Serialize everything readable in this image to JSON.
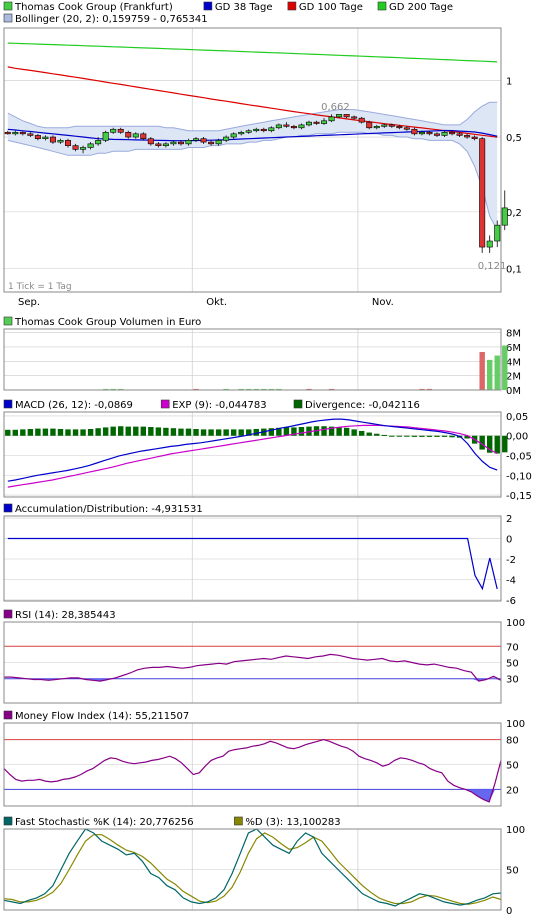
{
  "legend": {
    "main": [
      {
        "label": "Thomas Cook Group (Frankfurt)",
        "color": "#44cc44",
        "bordered": true
      },
      {
        "label": "GD 38 Tage",
        "color": "#0000cc"
      },
      {
        "label": "GD 100 Tage",
        "color": "#dd0000"
      },
      {
        "label": "GD 200 Tage",
        "color": "#22cc22"
      },
      {
        "label": "Bollinger (20, 2): 0,159759 - 0,765341",
        "color": "#aabbdd"
      }
    ],
    "volume": {
      "label": "Thomas Cook Group Volumen in Euro",
      "color": "#55cc55"
    },
    "macd": [
      {
        "label": "MACD (26, 12): -0,0869",
        "color": "#0000cc"
      },
      {
        "label": "EXP (9): -0,044783",
        "color": "#cc00cc"
      },
      {
        "label": "Divergence: -0,042116",
        "color": "#006600"
      }
    ],
    "ad": {
      "label": "Accumulation/Distribution: -4,931531",
      "color": "#0000cc"
    },
    "rsi": {
      "label": "RSI (14): 28,385443",
      "color": "#880088"
    },
    "mfi": {
      "label": "Money Flow Index (14): 55,211507",
      "color": "#880088"
    },
    "stoch": [
      {
        "label": "Fast Stochastic %K (14): 20,776256",
        "color": "#006666"
      },
      {
        "label": "%D (3): 13,100283",
        "color": "#888800"
      }
    ]
  },
  "x_axis": {
    "labels": [
      "Sep.",
      "Okt.",
      "Nov."
    ],
    "positions": [
      0,
      25,
      47
    ]
  },
  "main_axis": {
    "ticks": [
      "1",
      "0,5",
      "0,2",
      "0,1"
    ],
    "values": [
      1,
      0.5,
      0.2,
      0.1
    ],
    "ylim": [
      0.075,
      1.9
    ],
    "scale": "log"
  },
  "annotations": {
    "high_label": "0,662",
    "high_index": 44,
    "high_value": 0.662,
    "low_label": "0,121",
    "low_index": 64,
    "low_value": 0.121,
    "tick_note": "1 Tick = 1 Tag"
  },
  "volume_axis": {
    "ticks": [
      "8M",
      "6M",
      "4M",
      "2M",
      "0M"
    ],
    "values": [
      8,
      6,
      4,
      2,
      0
    ],
    "ylim": [
      0,
      8.5
    ]
  },
  "macd_axis": {
    "ticks": [
      "0,05",
      "0,00",
      "-0,05",
      "-0,10",
      "-0,15"
    ],
    "values": [
      0.05,
      0,
      -0.05,
      -0.1,
      -0.15
    ],
    "ylim": [
      -0.155,
      0.06
    ]
  },
  "ad_axis": {
    "ticks": [
      "2",
      "0",
      "-2",
      "-4",
      "-6"
    ],
    "values": [
      2,
      0,
      -2,
      -4,
      -6
    ],
    "ylim": [
      -6.1,
      2.2
    ]
  },
  "rsi_axis": {
    "ticks": [
      "100",
      "70",
      "50",
      "30"
    ],
    "values": [
      100,
      70,
      50,
      30
    ],
    "ylim": [
      0,
      100
    ],
    "upper": 70,
    "lower": 30
  },
  "mfi_axis": {
    "ticks": [
      "100",
      "80",
      "50",
      "20"
    ],
    "values": [
      100,
      80,
      50,
      20
    ],
    "ylim": [
      0,
      100
    ],
    "upper": 80,
    "lower": 20
  },
  "stoch_axis": {
    "ticks": [
      "100",
      "50",
      "0"
    ],
    "values": [
      100,
      50,
      0
    ],
    "ylim": [
      0,
      100
    ]
  },
  "colors": {
    "up": "#44cc44",
    "down": "#dd3333",
    "grid": "#cccccc",
    "band": "#dde6f5",
    "band_line": "#99aadd",
    "panel_border": "#888888",
    "vol_up": "#66cc66",
    "vol_down": "#dd6666"
  },
  "chart_data": {
    "type": "line",
    "x_count": 66,
    "candles": [
      [
        0.53,
        0.52,
        0.54,
        0.515
      ],
      [
        0.52,
        0.53,
        0.54,
        0.51
      ],
      [
        0.53,
        0.52,
        0.535,
        0.51
      ],
      [
        0.52,
        0.51,
        0.53,
        0.5
      ],
      [
        0.51,
        0.49,
        0.52,
        0.48
      ],
      [
        0.49,
        0.5,
        0.51,
        0.48
      ],
      [
        0.5,
        0.47,
        0.51,
        0.46
      ],
      [
        0.47,
        0.48,
        0.49,
        0.46
      ],
      [
        0.48,
        0.45,
        0.49,
        0.44
      ],
      [
        0.45,
        0.43,
        0.46,
        0.42
      ],
      [
        0.43,
        0.44,
        0.45,
        0.41
      ],
      [
        0.44,
        0.46,
        0.47,
        0.43
      ],
      [
        0.46,
        0.48,
        0.5,
        0.45
      ],
      [
        0.48,
        0.53,
        0.54,
        0.47
      ],
      [
        0.53,
        0.55,
        0.56,
        0.52
      ],
      [
        0.55,
        0.53,
        0.56,
        0.52
      ],
      [
        0.53,
        0.5,
        0.54,
        0.49
      ],
      [
        0.5,
        0.52,
        0.53,
        0.49
      ],
      [
        0.52,
        0.49,
        0.53,
        0.48
      ],
      [
        0.49,
        0.46,
        0.5,
        0.45
      ],
      [
        0.46,
        0.45,
        0.47,
        0.44
      ],
      [
        0.45,
        0.46,
        0.47,
        0.44
      ],
      [
        0.46,
        0.47,
        0.48,
        0.45
      ],
      [
        0.47,
        0.46,
        0.48,
        0.45
      ],
      [
        0.46,
        0.48,
        0.49,
        0.45
      ],
      [
        0.48,
        0.49,
        0.5,
        0.47
      ],
      [
        0.49,
        0.47,
        0.5,
        0.46
      ],
      [
        0.47,
        0.46,
        0.48,
        0.45
      ],
      [
        0.46,
        0.48,
        0.49,
        0.45
      ],
      [
        0.48,
        0.5,
        0.51,
        0.47
      ],
      [
        0.5,
        0.52,
        0.53,
        0.49
      ],
      [
        0.52,
        0.53,
        0.54,
        0.51
      ],
      [
        0.53,
        0.54,
        0.55,
        0.52
      ],
      [
        0.54,
        0.55,
        0.56,
        0.53
      ],
      [
        0.55,
        0.54,
        0.56,
        0.53
      ],
      [
        0.54,
        0.56,
        0.57,
        0.53
      ],
      [
        0.56,
        0.58,
        0.59,
        0.55
      ],
      [
        0.58,
        0.57,
        0.6,
        0.56
      ],
      [
        0.57,
        0.56,
        0.58,
        0.55
      ],
      [
        0.56,
        0.58,
        0.59,
        0.55
      ],
      [
        0.58,
        0.6,
        0.61,
        0.57
      ],
      [
        0.6,
        0.59,
        0.61,
        0.58
      ],
      [
        0.59,
        0.61,
        0.63,
        0.58
      ],
      [
        0.61,
        0.64,
        0.66,
        0.6
      ],
      [
        0.64,
        0.66,
        0.662,
        0.63
      ],
      [
        0.66,
        0.64,
        0.66,
        0.63
      ],
      [
        0.64,
        0.63,
        0.65,
        0.62
      ],
      [
        0.63,
        0.6,
        0.64,
        0.59
      ],
      [
        0.6,
        0.56,
        0.61,
        0.55
      ],
      [
        0.56,
        0.57,
        0.58,
        0.55
      ],
      [
        0.57,
        0.58,
        0.59,
        0.56
      ],
      [
        0.58,
        0.57,
        0.59,
        0.56
      ],
      [
        0.57,
        0.56,
        0.58,
        0.55
      ],
      [
        0.56,
        0.55,
        0.57,
        0.54
      ],
      [
        0.55,
        0.52,
        0.56,
        0.51
      ],
      [
        0.52,
        0.53,
        0.54,
        0.51
      ],
      [
        0.53,
        0.52,
        0.54,
        0.51
      ],
      [
        0.52,
        0.51,
        0.53,
        0.5
      ],
      [
        0.51,
        0.53,
        0.54,
        0.5
      ],
      [
        0.53,
        0.52,
        0.54,
        0.51
      ],
      [
        0.52,
        0.51,
        0.53,
        0.5
      ],
      [
        0.51,
        0.5,
        0.52,
        0.49
      ],
      [
        0.5,
        0.49,
        0.51,
        0.48
      ],
      [
        0.49,
        0.13,
        0.5,
        0.121
      ],
      [
        0.13,
        0.14,
        0.15,
        0.121
      ],
      [
        0.14,
        0.17,
        0.18,
        0.13
      ],
      [
        0.17,
        0.21,
        0.26,
        0.16
      ]
    ],
    "ma38": [
      0.55,
      0.545,
      0.54,
      0.535,
      0.53,
      0.525,
      0.52,
      0.515,
      0.51,
      0.505,
      0.5,
      0.495,
      0.49,
      0.488,
      0.486,
      0.485,
      0.484,
      0.483,
      0.482,
      0.481,
      0.48,
      0.479,
      0.478,
      0.478,
      0.478,
      0.479,
      0.48,
      0.481,
      0.482,
      0.484,
      0.486,
      0.488,
      0.49,
      0.492,
      0.494,
      0.496,
      0.498,
      0.5,
      0.502,
      0.504,
      0.506,
      0.508,
      0.51,
      0.512,
      0.514,
      0.516,
      0.518,
      0.52,
      0.522,
      0.524,
      0.526,
      0.528,
      0.53,
      0.532,
      0.534,
      0.536,
      0.538,
      0.54,
      0.542,
      0.541,
      0.538,
      0.535,
      0.532,
      0.525,
      0.515,
      0.505
    ],
    "ma100": [
      1.18,
      1.16,
      1.145,
      1.13,
      1.115,
      1.1,
      1.085,
      1.07,
      1.055,
      1.04,
      1.025,
      1.01,
      0.995,
      0.98,
      0.966,
      0.952,
      0.938,
      0.924,
      0.91,
      0.897,
      0.884,
      0.871,
      0.858,
      0.845,
      0.833,
      0.821,
      0.809,
      0.797,
      0.786,
      0.775,
      0.764,
      0.753,
      0.742,
      0.732,
      0.722,
      0.712,
      0.702,
      0.692,
      0.683,
      0.674,
      0.665,
      0.656,
      0.648,
      0.64,
      0.632,
      0.624,
      0.617,
      0.61,
      0.603,
      0.596,
      0.589,
      0.583,
      0.577,
      0.571,
      0.565,
      0.559,
      0.553,
      0.547,
      0.541,
      0.535,
      0.529,
      0.523,
      0.517,
      0.511,
      0.505,
      0.499
    ],
    "ma200": [
      1.58,
      1.575,
      1.57,
      1.565,
      1.56,
      1.555,
      1.55,
      1.545,
      1.54,
      1.535,
      1.53,
      1.525,
      1.52,
      1.515,
      1.51,
      1.505,
      1.5,
      1.495,
      1.49,
      1.485,
      1.48,
      1.475,
      1.47,
      1.465,
      1.46,
      1.455,
      1.45,
      1.445,
      1.44,
      1.435,
      1.43,
      1.425,
      1.42,
      1.415,
      1.41,
      1.405,
      1.4,
      1.395,
      1.39,
      1.385,
      1.38,
      1.375,
      1.37,
      1.365,
      1.36,
      1.355,
      1.35,
      1.345,
      1.34,
      1.335,
      1.33,
      1.325,
      1.32,
      1.315,
      1.31,
      1.305,
      1.3,
      1.295,
      1.29,
      1.285,
      1.28,
      1.275,
      1.27,
      1.265,
      1.26,
      1.255
    ],
    "boll_upper": [
      0.67,
      0.64,
      0.61,
      0.59,
      0.57,
      0.56,
      0.56,
      0.56,
      0.56,
      0.57,
      0.57,
      0.57,
      0.57,
      0.57,
      0.57,
      0.57,
      0.57,
      0.57,
      0.57,
      0.57,
      0.57,
      0.56,
      0.56,
      0.55,
      0.54,
      0.54,
      0.54,
      0.54,
      0.54,
      0.55,
      0.56,
      0.57,
      0.58,
      0.59,
      0.6,
      0.61,
      0.62,
      0.63,
      0.64,
      0.65,
      0.66,
      0.67,
      0.68,
      0.69,
      0.7,
      0.7,
      0.7,
      0.69,
      0.68,
      0.67,
      0.66,
      0.65,
      0.64,
      0.63,
      0.62,
      0.61,
      0.6,
      0.59,
      0.58,
      0.58,
      0.58,
      0.62,
      0.68,
      0.73,
      0.765,
      0.765
    ],
    "boll_lower": [
      0.48,
      0.47,
      0.46,
      0.45,
      0.44,
      0.43,
      0.42,
      0.41,
      0.4,
      0.4,
      0.4,
      0.4,
      0.41,
      0.41,
      0.42,
      0.42,
      0.42,
      0.43,
      0.43,
      0.43,
      0.43,
      0.43,
      0.43,
      0.43,
      0.44,
      0.44,
      0.44,
      0.45,
      0.45,
      0.46,
      0.46,
      0.46,
      0.47,
      0.47,
      0.48,
      0.48,
      0.49,
      0.5,
      0.5,
      0.51,
      0.51,
      0.52,
      0.52,
      0.52,
      0.53,
      0.53,
      0.53,
      0.53,
      0.52,
      0.52,
      0.51,
      0.51,
      0.5,
      0.5,
      0.49,
      0.49,
      0.48,
      0.48,
      0.48,
      0.48,
      0.46,
      0.42,
      0.35,
      0.27,
      0.19,
      0.16
    ],
    "volume": [
      0,
      0,
      0,
      0,
      0,
      0,
      0,
      0,
      0,
      0,
      0,
      0,
      0,
      0.15,
      0.15,
      0.15,
      0,
      0,
      0,
      0,
      0,
      0,
      0,
      0,
      0,
      0.15,
      0,
      0,
      0,
      0.15,
      0,
      0.15,
      0.15,
      0.15,
      0.15,
      0.15,
      0.15,
      0,
      0,
      0,
      0.15,
      0,
      0,
      0.15,
      0,
      0,
      0,
      0,
      0,
      0,
      0,
      0,
      0,
      0,
      0,
      0.15,
      0.15,
      0,
      0,
      0,
      0,
      0,
      0,
      5.3,
      4.2,
      4.8,
      6.2
    ],
    "volume_up": [
      1,
      1,
      1,
      1,
      1,
      1,
      1,
      1,
      1,
      1,
      1,
      1,
      1,
      1,
      1,
      1,
      1,
      1,
      1,
      1,
      1,
      1,
      1,
      1,
      1,
      0,
      1,
      1,
      1,
      1,
      1,
      1,
      1,
      1,
      1,
      1,
      1,
      1,
      1,
      1,
      0,
      1,
      1,
      0,
      1,
      1,
      1,
      1,
      1,
      1,
      1,
      1,
      1,
      1,
      1,
      0,
      0,
      1,
      1,
      1,
      1,
      1,
      1,
      0,
      1,
      1,
      1
    ],
    "macd": [
      -0.115,
      -0.112,
      -0.108,
      -0.104,
      -0.1,
      -0.097,
      -0.094,
      -0.091,
      -0.088,
      -0.084,
      -0.08,
      -0.075,
      -0.069,
      -0.063,
      -0.057,
      -0.051,
      -0.047,
      -0.043,
      -0.039,
      -0.036,
      -0.033,
      -0.03,
      -0.027,
      -0.025,
      -0.022,
      -0.02,
      -0.018,
      -0.015,
      -0.012,
      -0.009,
      -0.006,
      -0.003,
      0.0,
      0.004,
      0.008,
      0.012,
      0.016,
      0.02,
      0.023,
      0.027,
      0.031,
      0.035,
      0.038,
      0.04,
      0.042,
      0.042,
      0.04,
      0.037,
      0.034,
      0.031,
      0.028,
      0.025,
      0.023,
      0.021,
      0.019,
      0.017,
      0.015,
      0.013,
      0.011,
      0.008,
      0.004,
      -0.002,
      -0.02,
      -0.045,
      -0.065,
      -0.08,
      -0.087
    ],
    "signal": [
      -0.13,
      -0.127,
      -0.124,
      -0.121,
      -0.118,
      -0.115,
      -0.112,
      -0.108,
      -0.104,
      -0.1,
      -0.096,
      -0.092,
      -0.088,
      -0.084,
      -0.08,
      -0.075,
      -0.07,
      -0.066,
      -0.062,
      -0.058,
      -0.054,
      -0.05,
      -0.046,
      -0.043,
      -0.04,
      -0.037,
      -0.034,
      -0.031,
      -0.028,
      -0.025,
      -0.022,
      -0.019,
      -0.016,
      -0.013,
      -0.01,
      -0.007,
      -0.004,
      -0.001,
      0.002,
      0.005,
      0.008,
      0.011,
      0.014,
      0.017,
      0.02,
      0.022,
      0.024,
      0.025,
      0.026,
      0.026,
      0.026,
      0.025,
      0.024,
      0.023,
      0.022,
      0.02,
      0.018,
      0.016,
      0.014,
      0.012,
      0.009,
      0.005,
      0.0,
      -0.01,
      -0.022,
      -0.035,
      -0.045
    ],
    "ad": [
      0,
      0,
      0,
      0,
      0,
      0,
      0,
      0,
      0,
      0,
      0,
      0,
      0,
      0,
      0,
      0,
      0,
      0,
      0,
      0,
      0,
      0,
      0,
      0,
      0,
      0,
      0,
      0,
      0,
      0,
      0,
      0,
      0,
      0,
      0,
      0,
      0,
      0,
      0,
      0,
      0,
      0,
      0,
      0,
      0,
      0,
      0,
      0,
      0,
      0,
      0,
      0,
      0,
      0,
      0,
      0,
      0,
      0,
      0,
      0,
      0,
      0,
      0,
      -3.6,
      -4.9,
      -1.9,
      -4.93
    ],
    "rsi": [
      32,
      32,
      31,
      30,
      29,
      29,
      28,
      29,
      30,
      31,
      31,
      29,
      28,
      27,
      29,
      31,
      34,
      37,
      41,
      43,
      44,
      44,
      45,
      44,
      43,
      44,
      46,
      47,
      48,
      49,
      48,
      51,
      52,
      53,
      54,
      55,
      54,
      56,
      58,
      57,
      56,
      55,
      57,
      58,
      60,
      59,
      57,
      55,
      54,
      53,
      54,
      55,
      52,
      51,
      52,
      50,
      48,
      47,
      48,
      46,
      44,
      43,
      40,
      38,
      27,
      29,
      33,
      28
    ],
    "mfi": [
      45,
      38,
      32,
      30,
      31,
      31,
      32,
      30,
      29,
      30,
      32,
      33,
      35,
      38,
      42,
      45,
      50,
      55,
      58,
      57,
      54,
      52,
      51,
      52,
      53,
      55,
      56,
      58,
      60,
      57,
      52,
      45,
      38,
      40,
      48,
      55,
      58,
      60,
      66,
      68,
      69,
      70,
      72,
      73,
      75,
      78,
      76,
      73,
      70,
      69,
      71,
      74,
      76,
      78,
      80,
      78,
      75,
      72,
      70,
      66,
      60,
      57,
      55,
      52,
      48,
      50,
      55,
      58,
      57,
      55,
      52,
      50,
      45,
      42,
      40,
      30,
      25,
      22,
      20,
      17,
      12,
      8,
      5,
      28,
      55
    ],
    "stoch_k": [
      12,
      10,
      8,
      12,
      15,
      20,
      30,
      50,
      70,
      85,
      100,
      95,
      85,
      80,
      75,
      68,
      70,
      60,
      45,
      40,
      30,
      25,
      15,
      10,
      8,
      10,
      15,
      25,
      45,
      70,
      95,
      100,
      90,
      80,
      75,
      70,
      85,
      95,
      90,
      70,
      60,
      50,
      40,
      30,
      20,
      15,
      10,
      8,
      5,
      10,
      15,
      20,
      18,
      14,
      10,
      8,
      6,
      8,
      12,
      15,
      20,
      21
    ],
    "stoch_d": [
      14,
      13,
      10,
      10,
      12,
      16,
      22,
      33,
      50,
      68,
      85,
      93,
      93,
      87,
      80,
      74,
      71,
      66,
      58,
      48,
      38,
      32,
      23,
      17,
      11,
      9,
      11,
      17,
      28,
      47,
      70,
      88,
      95,
      90,
      82,
      75,
      77,
      83,
      90,
      85,
      73,
      60,
      50,
      40,
      30,
      22,
      15,
      11,
      8,
      8,
      10,
      15,
      18,
      17,
      14,
      11,
      8,
      7,
      9,
      12,
      16,
      13
    ]
  }
}
